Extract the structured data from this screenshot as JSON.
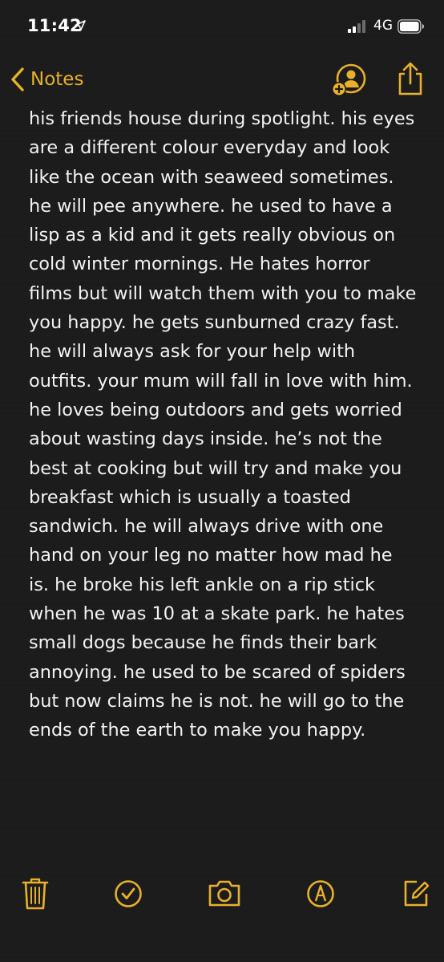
{
  "status_bar": {
    "time": "11:42",
    "network": "4G"
  },
  "nav": {
    "back_label": "Notes"
  },
  "note": {
    "lines": [
      "his friends house during spotlight. his eyes",
      "are a different colour everyday and look",
      "like the ocean with seaweed sometimes.",
      "he will pee anywhere. he used to have a",
      "lisp as a kid and it gets really obvious on",
      "cold winter mornings. He hates horror",
      "films but will watch them with you to make",
      "you happy. he gets sunburned crazy fast.",
      "he will always ask for your help with",
      "outfits. your mum will fall in love with him.",
      "he loves being outdoors and gets worried",
      "about wasting days inside. he’s not the",
      "best at cooking but will try and make you",
      "breakfast which is usually a toasted",
      "sandwich. he will always drive with one",
      "hand on your leg no matter how mad he",
      "is. he broke his left ankle on a rip stick",
      "when he was 10 at a skate park. he hates",
      "small dogs because he finds their bark",
      "annoying. he used to be scared of spiders",
      "but now claims he is not. he will go to the",
      "ends of the earth to make you happy."
    ]
  },
  "toolbar": {
    "icons": [
      "trash-icon",
      "checklist-icon",
      "camera-icon",
      "markup-icon",
      "compose-icon"
    ]
  },
  "colors": {
    "accent": "#e8b128",
    "background": "#1b1b1c",
    "text": "#f2f2f2"
  }
}
